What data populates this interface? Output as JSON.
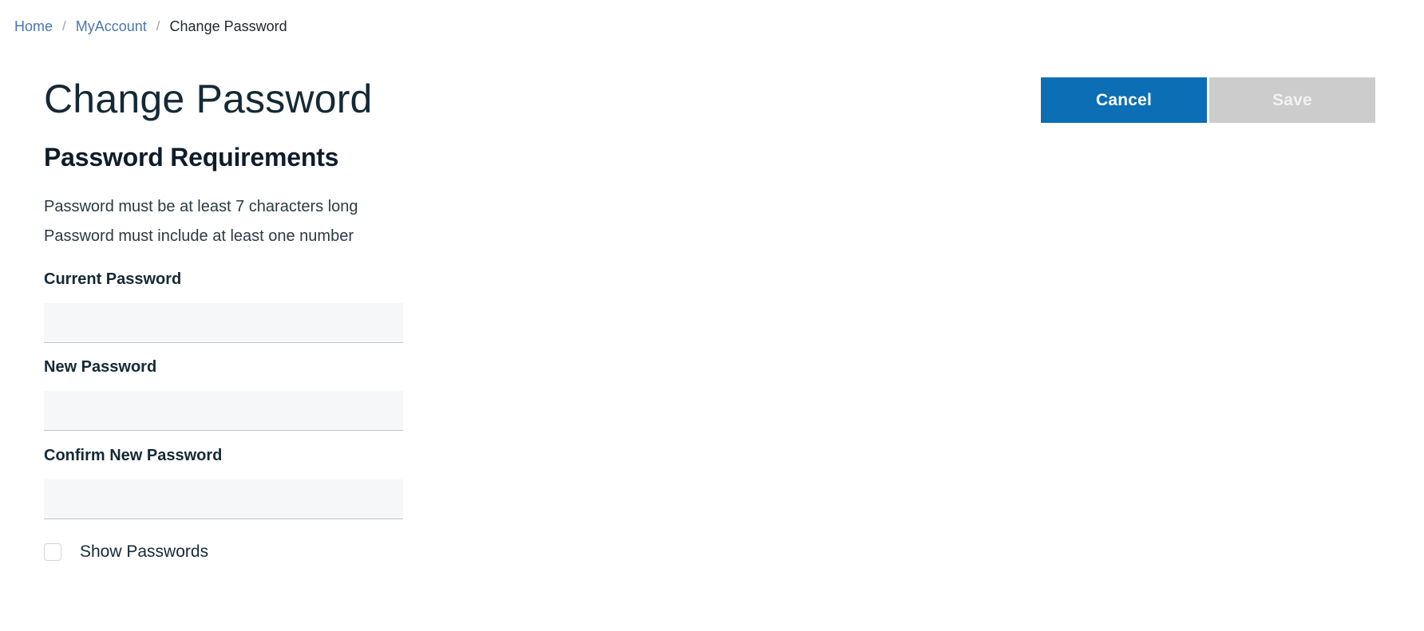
{
  "breadcrumb": {
    "items": [
      {
        "label": "Home",
        "type": "link"
      },
      {
        "label": "MyAccount",
        "type": "link"
      },
      {
        "label": "Change Password",
        "type": "current"
      }
    ],
    "separator": "/"
  },
  "header": {
    "title": "Change Password"
  },
  "toolbar": {
    "cancel_label": "Cancel",
    "save_label": "Save",
    "cancel_color": "#0c6eb4",
    "save_color": "#cccccc"
  },
  "requirements": {
    "title": "Password Requirements",
    "lines": [
      "Password must be at least 7 characters long",
      "Password must include at least one number"
    ]
  },
  "form": {
    "fields": [
      {
        "label": "Current Password",
        "value": "",
        "placeholder": ""
      },
      {
        "label": "New Password",
        "value": "",
        "placeholder": ""
      },
      {
        "label": "Confirm New Password",
        "value": "",
        "placeholder": ""
      }
    ],
    "show_passwords": {
      "label": "Show Passwords",
      "checked": false
    }
  },
  "colors": {
    "link": "#4a76b0",
    "text": "#152935",
    "field_background": "#f6f7f9",
    "field_underline": "#c4c8cc"
  }
}
